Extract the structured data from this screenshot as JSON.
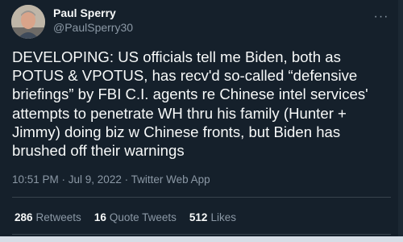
{
  "author": {
    "name": "Paul Sperry",
    "handle": "@PaulSperry30"
  },
  "tweet": {
    "text": "DEVELOPING: US officials tell me Biden, both as\nPOTUS & VPOTUS, has recv'd so-called “defensive\nbriefings” by FBI C.I. agents re Chinese intel services'\nattempts to penetrate WH thru his family (Hunter +\nJimmy) doing biz w Chinese fronts, but Biden has\nbrushed off their warnings",
    "meta": "10:51 PM · Jul 9, 2022 · Twitter Web App"
  },
  "stats": {
    "retweets_count": "286",
    "retweets_label": "Retweets",
    "quotes_count": "16",
    "quotes_label": "Quote Tweets",
    "likes_count": "512",
    "likes_label": "Likes"
  },
  "icons": {
    "more": "more-options-icon",
    "avatar": "profile-photo"
  },
  "colors": {
    "background": "#15202b",
    "text_primary": "#f7f9f9",
    "text_secondary": "#8b98a5",
    "divider": "#38444d"
  }
}
